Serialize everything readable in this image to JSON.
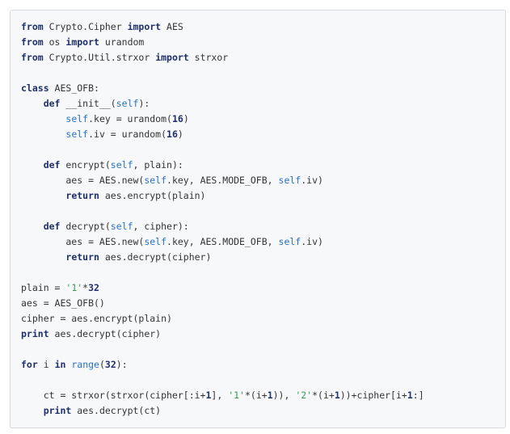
{
  "code_lines": [
    [
      {
        "t": "k",
        "v": "from"
      },
      {
        "t": "t",
        "v": " Crypto.Cipher "
      },
      {
        "t": "k",
        "v": "import"
      },
      {
        "t": "t",
        "v": " AES"
      }
    ],
    [
      {
        "t": "k",
        "v": "from"
      },
      {
        "t": "t",
        "v": " os "
      },
      {
        "t": "k",
        "v": "import"
      },
      {
        "t": "t",
        "v": " urandom"
      }
    ],
    [
      {
        "t": "k",
        "v": "from"
      },
      {
        "t": "t",
        "v": " Crypto.Util.strxor "
      },
      {
        "t": "k",
        "v": "import"
      },
      {
        "t": "t",
        "v": " strxor"
      }
    ],
    [],
    [
      {
        "t": "k",
        "v": "class"
      },
      {
        "t": "t",
        "v": " AES_OFB:"
      }
    ],
    [
      {
        "t": "t",
        "v": "    "
      },
      {
        "t": "k",
        "v": "def"
      },
      {
        "t": "t",
        "v": " __init__("
      },
      {
        "t": "s",
        "v": "self"
      },
      {
        "t": "t",
        "v": "):"
      }
    ],
    [
      {
        "t": "t",
        "v": "        "
      },
      {
        "t": "s",
        "v": "self"
      },
      {
        "t": "t",
        "v": ".key = urandom("
      },
      {
        "t": "n",
        "v": "16"
      },
      {
        "t": "t",
        "v": ")"
      }
    ],
    [
      {
        "t": "t",
        "v": "        "
      },
      {
        "t": "s",
        "v": "self"
      },
      {
        "t": "t",
        "v": ".iv = urandom("
      },
      {
        "t": "n",
        "v": "16"
      },
      {
        "t": "t",
        "v": ")"
      }
    ],
    [],
    [
      {
        "t": "t",
        "v": "    "
      },
      {
        "t": "k",
        "v": "def"
      },
      {
        "t": "t",
        "v": " encrypt("
      },
      {
        "t": "s",
        "v": "self"
      },
      {
        "t": "t",
        "v": ", plain):"
      }
    ],
    [
      {
        "t": "t",
        "v": "        aes = AES.new("
      },
      {
        "t": "s",
        "v": "self"
      },
      {
        "t": "t",
        "v": ".key, AES.MODE_OFB, "
      },
      {
        "t": "s",
        "v": "self"
      },
      {
        "t": "t",
        "v": ".iv)"
      }
    ],
    [
      {
        "t": "t",
        "v": "        "
      },
      {
        "t": "k",
        "v": "return"
      },
      {
        "t": "t",
        "v": " aes.encrypt(plain)"
      }
    ],
    [],
    [
      {
        "t": "t",
        "v": "    "
      },
      {
        "t": "k",
        "v": "def"
      },
      {
        "t": "t",
        "v": " decrypt("
      },
      {
        "t": "s",
        "v": "self"
      },
      {
        "t": "t",
        "v": ", cipher):"
      }
    ],
    [
      {
        "t": "t",
        "v": "        aes = AES.new("
      },
      {
        "t": "s",
        "v": "self"
      },
      {
        "t": "t",
        "v": ".key, AES.MODE_OFB, "
      },
      {
        "t": "s",
        "v": "self"
      },
      {
        "t": "t",
        "v": ".iv)"
      }
    ],
    [
      {
        "t": "t",
        "v": "        "
      },
      {
        "t": "k",
        "v": "return"
      },
      {
        "t": "t",
        "v": " aes.decrypt(cipher)"
      }
    ],
    [],
    [
      {
        "t": "t",
        "v": "plain = "
      },
      {
        "t": "str",
        "v": "'1'"
      },
      {
        "t": "t",
        "v": "*"
      },
      {
        "t": "n",
        "v": "32"
      }
    ],
    [
      {
        "t": "t",
        "v": "aes = AES_OFB()"
      }
    ],
    [
      {
        "t": "t",
        "v": "cipher = aes.encrypt(plain)"
      }
    ],
    [
      {
        "t": "k",
        "v": "print"
      },
      {
        "t": "t",
        "v": " aes.decrypt(cipher)"
      }
    ],
    [],
    [
      {
        "t": "k",
        "v": "for"
      },
      {
        "t": "t",
        "v": " i "
      },
      {
        "t": "k",
        "v": "in"
      },
      {
        "t": "t",
        "v": " "
      },
      {
        "t": "s",
        "v": "range"
      },
      {
        "t": "t",
        "v": "("
      },
      {
        "t": "n",
        "v": "32"
      },
      {
        "t": "t",
        "v": "):"
      }
    ],
    [],
    [
      {
        "t": "t",
        "v": "    ct = strxor(strxor(cipher[:i+"
      },
      {
        "t": "n",
        "v": "1"
      },
      {
        "t": "t",
        "v": "], "
      },
      {
        "t": "str",
        "v": "'1'"
      },
      {
        "t": "t",
        "v": "*(i+"
      },
      {
        "t": "n",
        "v": "1"
      },
      {
        "t": "t",
        "v": ")), "
      },
      {
        "t": "str",
        "v": "'2'"
      },
      {
        "t": "t",
        "v": "*(i+"
      },
      {
        "t": "n",
        "v": "1"
      },
      {
        "t": "t",
        "v": "))+cipher[i+"
      },
      {
        "t": "n",
        "v": "1"
      },
      {
        "t": "t",
        "v": ":]"
      }
    ],
    [
      {
        "t": "t",
        "v": "    "
      },
      {
        "t": "k",
        "v": "print"
      },
      {
        "t": "t",
        "v": " aes.decrypt(ct)"
      }
    ]
  ]
}
